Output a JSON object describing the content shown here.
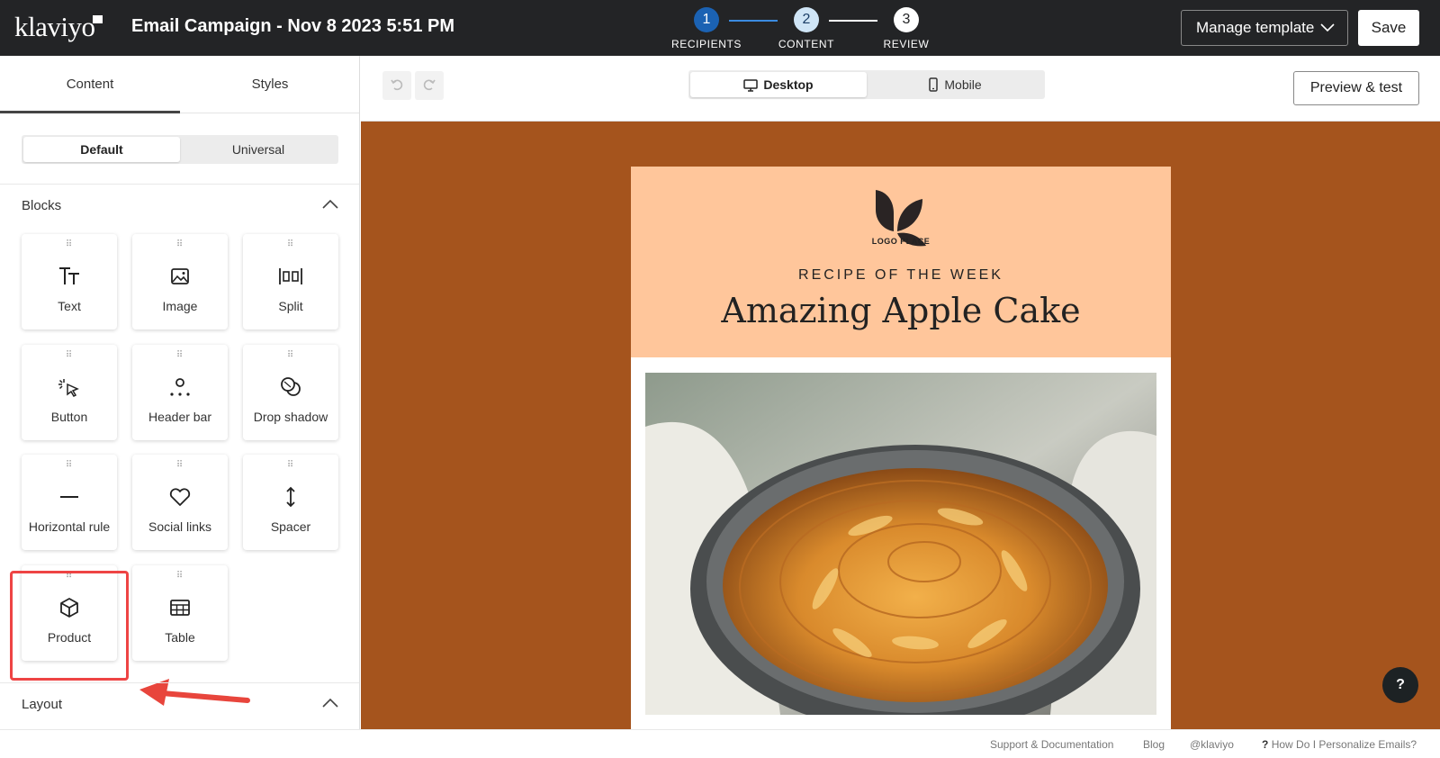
{
  "app": {
    "logo_text": "klaviyo",
    "campaign_title": "Email Campaign - Nov 8 2023 5:51 PM"
  },
  "steps": [
    {
      "number": "1",
      "label": "RECIPIENTS"
    },
    {
      "number": "2",
      "label": "CONTENT"
    },
    {
      "number": "3",
      "label": "REVIEW"
    }
  ],
  "header_actions": {
    "manage_template": "Manage template",
    "save": "Save"
  },
  "left_panel": {
    "tabs": [
      "Content",
      "Styles"
    ],
    "toggle": [
      "Default",
      "Universal"
    ],
    "blocks_heading": "Blocks",
    "layout_heading": "Layout",
    "blocks": [
      {
        "label": "Text",
        "icon": "text-icon"
      },
      {
        "label": "Image",
        "icon": "image-icon"
      },
      {
        "label": "Split",
        "icon": "split-icon"
      },
      {
        "label": "Button",
        "icon": "button-click-icon"
      },
      {
        "label": "Header bar",
        "icon": "header-bar-icon"
      },
      {
        "label": "Drop shadow",
        "icon": "drop-shadow-icon"
      },
      {
        "label": "Horizontal rule",
        "icon": "horizontal-rule-icon"
      },
      {
        "label": "Social links",
        "icon": "heart-icon"
      },
      {
        "label": "Spacer",
        "icon": "spacer-icon"
      },
      {
        "label": "Product",
        "icon": "cube-icon"
      },
      {
        "label": "Table",
        "icon": "table-icon"
      }
    ]
  },
  "toolbar": {
    "view_options": [
      "Desktop",
      "Mobile"
    ],
    "preview": "Preview & test"
  },
  "email": {
    "logo_caption": "LOGO PLACE",
    "kicker": "RECIPE OF THE WEEK",
    "headline": "Amazing Apple Cake",
    "header_bg": "#ffc69b",
    "canvas_bg": "#a5541d"
  },
  "help_label": "?",
  "footer": {
    "links": [
      "Support & Documentation",
      "Blog",
      "@klaviyo",
      "How Do I Personalize Emails?"
    ]
  }
}
